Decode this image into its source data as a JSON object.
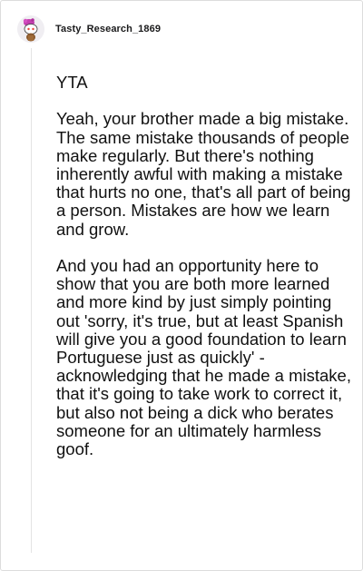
{
  "comment": {
    "author": "Tasty_Research_1869",
    "avatar_icon": "snoo-avatar-icon",
    "paragraphs": [
      "YTA",
      "Yeah, your brother made a big mistake. The same mistake thousands of people make regularly. But there's nothing inherently awful with making a mistake that hurts no one, that's all part of being a person. Mistakes are how we learn and grow.",
      "And you had an opportunity here to show that you are both more learned and more kind by just simply pointing out 'sorry, it's true, but at least Spanish will give you a good foundation to learn Portuguese just as quickly' - acknowledging that he made a mistake, that it's going to take work to correct it, but also not being a dick who berates someone for an ultimately harmless goof."
    ]
  }
}
